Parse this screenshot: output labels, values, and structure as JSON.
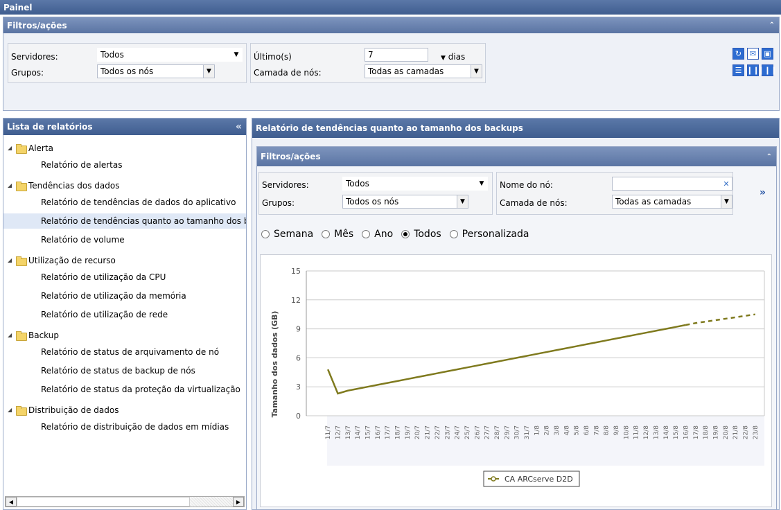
{
  "app": {
    "title": "Painel"
  },
  "top_filters": {
    "title": "Filtros/ações",
    "servers_label": "Servidores:",
    "servers_value": "Todos",
    "groups_label": "Grupos:",
    "groups_value": "Todos os nós",
    "last_label": "Último(s)",
    "last_value": "7",
    "days_label": "dias",
    "tier_label": "Camada de nós:",
    "tier_value": "Todas as camadas"
  },
  "toolbar": {
    "icons": [
      "refresh-icon",
      "email-icon",
      "export-icon",
      "list-view-icon",
      "two-column-view-icon",
      "three-column-view-icon"
    ]
  },
  "reports": {
    "title": "Lista de relatórios",
    "collapse_glyph": "«",
    "groups": [
      {
        "label": "Alerta",
        "items": [
          "Relatório de alertas"
        ]
      },
      {
        "label": "Tendências dos dados",
        "items": [
          "Relatório de tendências de dados do aplicativo",
          "Relatório de tendências quanto ao tamanho dos backups",
          "Relatório de volume"
        ]
      },
      {
        "label": "Utilização de recurso",
        "items": [
          "Relatório de utilização da CPU",
          "Relatório de utilização da memória",
          "Relatório de utilização de rede"
        ]
      },
      {
        "label": "Backup",
        "items": [
          "Relatório de status de arquivamento de nó",
          "Relatório de status de backup de nós",
          "Relatório de status da proteção da virtualização"
        ]
      },
      {
        "label": "Distribuição de dados",
        "items": [
          "Relatório de distribuição de dados em mídias"
        ]
      }
    ]
  },
  "report": {
    "title": "Relatório de tendências quanto ao tamanho dos backups",
    "filters_title": "Filtros/ações",
    "servers_label": "Servidores:",
    "servers_value": "Todos",
    "groups_label": "Grupos:",
    "groups_value": "Todos os nós",
    "node_name_label": "Nome do nó:",
    "node_name_value": "",
    "tier_label": "Camada de nós:",
    "tier_value": "Todas as camadas",
    "more_glyph": "»",
    "periods": [
      {
        "label": "Semana",
        "selected": false
      },
      {
        "label": "Mês",
        "selected": false
      },
      {
        "label": "Ano",
        "selected": false
      },
      {
        "label": "Todos",
        "selected": true
      },
      {
        "label": "Personalizada",
        "selected": false
      }
    ]
  },
  "chart_data": {
    "type": "line",
    "ylabel": "Tamanho dos dados (GB)",
    "xlabel": "",
    "ylim": [
      0,
      15
    ],
    "yticks": [
      0,
      3,
      6,
      9,
      12,
      15
    ],
    "x": [
      "11/7",
      "12/7",
      "13/7",
      "14/7",
      "15/7",
      "16/7",
      "17/7",
      "18/7",
      "19/7",
      "20/7",
      "21/7",
      "22/7",
      "23/7",
      "24/7",
      "25/7",
      "26/7",
      "27/7",
      "28/7",
      "29/7",
      "30/7",
      "31/7",
      "1/8",
      "2/8",
      "3/8",
      "4/8",
      "5/8",
      "6/8",
      "7/8",
      "8/8",
      "9/8",
      "10/8",
      "11/8",
      "12/8",
      "13/8",
      "14/8",
      "15/8",
      "16/8",
      "17/8",
      "18/8",
      "19/8",
      "20/8",
      "21/8",
      "22/8",
      "23/8"
    ],
    "series": [
      {
        "name": "CA ARCserve D2D",
        "color": "#7f7a1e",
        "actual": [
          4.8,
          2.3,
          2.6,
          2.8,
          3.0,
          3.2,
          3.4,
          3.6,
          3.8,
          4.0,
          4.2,
          4.4,
          4.6,
          4.8,
          5.0,
          5.2,
          5.4,
          5.6,
          5.8,
          6.0,
          6.2,
          6.4,
          6.6,
          6.8,
          7.0,
          7.2,
          7.4,
          7.6,
          7.8,
          8.0,
          8.2,
          8.4,
          8.6,
          8.8,
          9.0,
          9.2,
          9.4
        ],
        "forecast_start_index": 36,
        "forecast": [
          9.4,
          9.6,
          9.75,
          9.9,
          10.05,
          10.2,
          10.35,
          10.5
        ]
      }
    ],
    "legend_position": "bottom-center",
    "grid": true
  }
}
